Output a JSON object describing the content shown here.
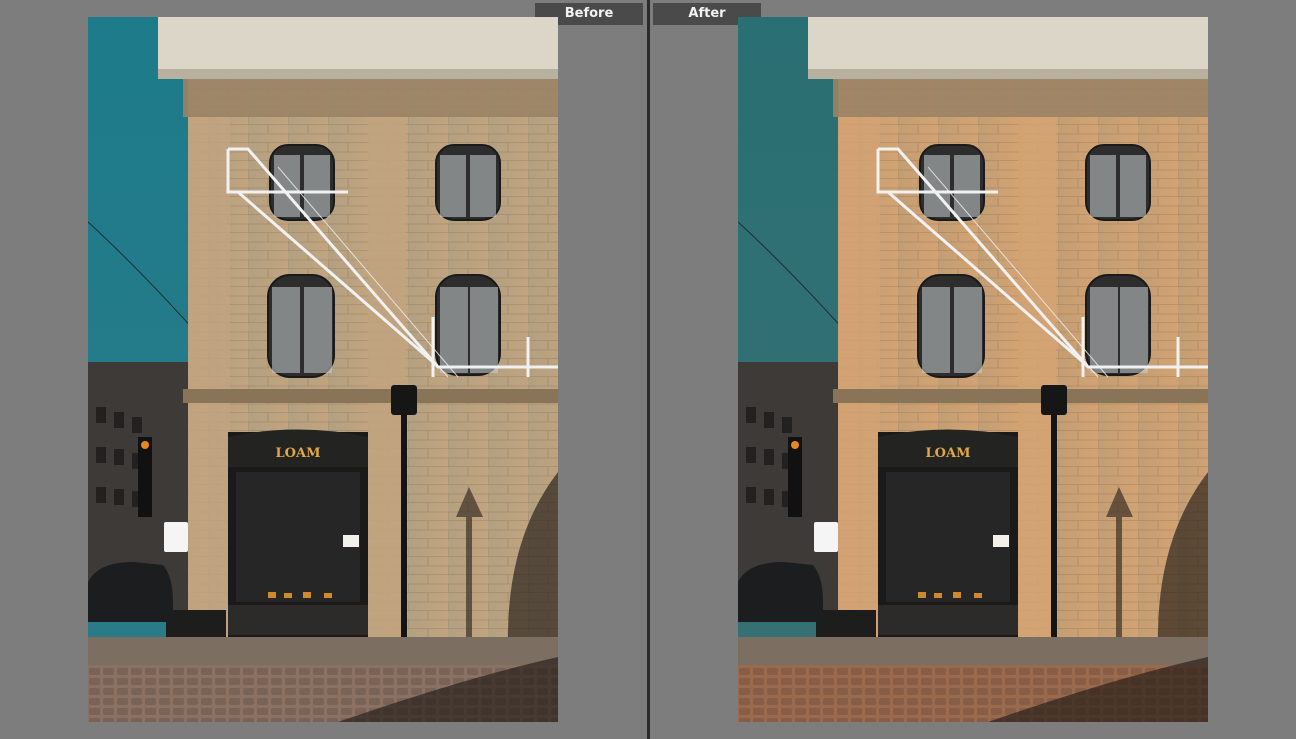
{
  "view": {
    "mode": "Before/After comparison",
    "before_label": "Before",
    "after_label": "After"
  },
  "photo": {
    "description_icon": "storefront-photo",
    "store_sign": "LOAM"
  },
  "colors": {
    "before_sky": "#1d7b8a",
    "after_sky": "#2a6f73",
    "before_wall": "#c2a47f",
    "after_wall": "#d3a373",
    "before_street": "#8a7162",
    "after_street": "#9a6a4e",
    "sign_text": "#e0a84a"
  }
}
